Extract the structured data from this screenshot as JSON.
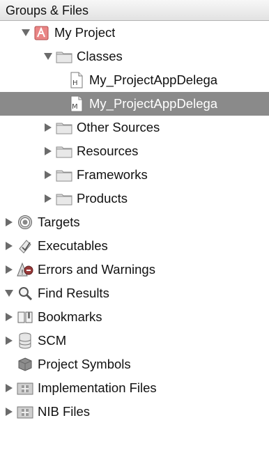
{
  "header": {
    "title": "Groups & Files"
  },
  "tree": [
    {
      "label": "My Project",
      "icon": "project-icon",
      "disclosure": "expanded",
      "depth": 1
    },
    {
      "label": "Classes",
      "icon": "folder-icon",
      "disclosure": "expanded",
      "depth": 2
    },
    {
      "label": "My_ProjectAppDelega",
      "icon": "header-file-icon",
      "disclosure": "none",
      "depth": 3
    },
    {
      "label": "My_ProjectAppDelega",
      "icon": "implementation-file-icon",
      "disclosure": "none",
      "depth": 3,
      "selected": true
    },
    {
      "label": "Other Sources",
      "icon": "folder-icon",
      "disclosure": "collapsed",
      "depth": 2
    },
    {
      "label": "Resources",
      "icon": "folder-icon",
      "disclosure": "collapsed",
      "depth": 2
    },
    {
      "label": "Frameworks",
      "icon": "folder-icon",
      "disclosure": "collapsed",
      "depth": 2
    },
    {
      "label": "Products",
      "icon": "folder-icon",
      "disclosure": "collapsed",
      "depth": 2
    },
    {
      "label": "Targets",
      "icon": "target-icon",
      "disclosure": "collapsed",
      "depth": 0
    },
    {
      "label": "Executables",
      "icon": "executable-icon",
      "disclosure": "collapsed",
      "depth": 0
    },
    {
      "label": "Errors and Warnings",
      "icon": "warning-icon",
      "disclosure": "collapsed",
      "depth": 0
    },
    {
      "label": "Find Results",
      "icon": "search-icon",
      "disclosure": "expanded",
      "depth": 0
    },
    {
      "label": "Bookmarks",
      "icon": "book-icon",
      "disclosure": "collapsed",
      "depth": 0
    },
    {
      "label": "SCM",
      "icon": "database-icon",
      "disclosure": "collapsed",
      "depth": 0
    },
    {
      "label": "Project Symbols",
      "icon": "cube-icon",
      "disclosure": "none",
      "depth": 0
    },
    {
      "label": "Implementation Files",
      "icon": "smart-group-icon",
      "disclosure": "collapsed",
      "depth": 0
    },
    {
      "label": "NIB Files",
      "icon": "smart-group-icon",
      "disclosure": "collapsed",
      "depth": 0
    }
  ],
  "colors": {
    "selection": "#8a8a8a",
    "header": "#e6e6e6"
  }
}
